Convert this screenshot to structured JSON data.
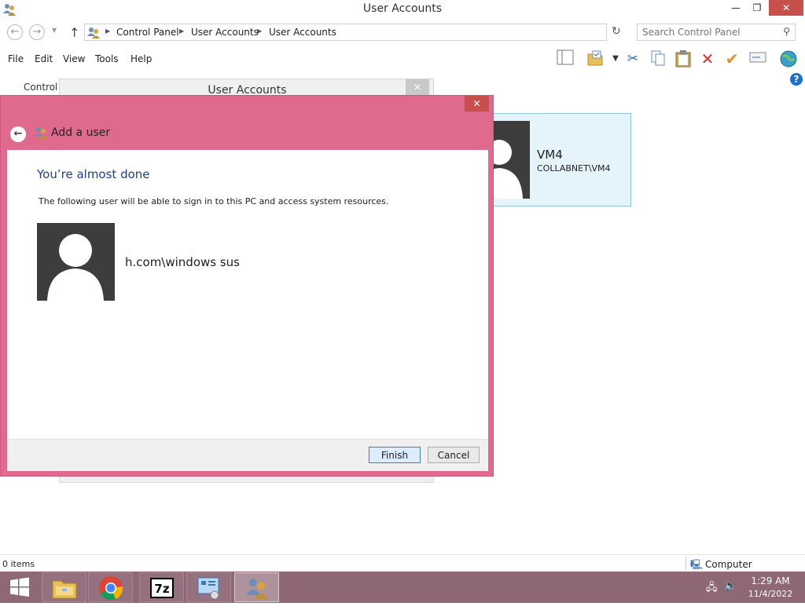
{
  "window": {
    "title": "User Accounts",
    "minimize_glyph": "—",
    "maximize_glyph": "❐",
    "close_glyph": "✕"
  },
  "address": {
    "crumbs": [
      "Control Panel",
      "User Accounts",
      "User Accounts"
    ],
    "search_placeholder": "Search Control Panel"
  },
  "menu": {
    "items": [
      "File",
      "Edit",
      "View",
      "Tools",
      "Help"
    ]
  },
  "toolbar": {
    "icons": [
      "layout-icon",
      "folder-options-icon",
      "cut-icon",
      "copy-icon",
      "paste-icon",
      "delete-icon",
      "check-icon",
      "rename-icon",
      "globe-icon"
    ]
  },
  "background": {
    "crumb": "Control P",
    "dialog_title": "User Accounts",
    "close_glyph": "✕",
    "user_tile": {
      "name": "VM4",
      "domain": "COLLABNET\\VM4"
    }
  },
  "dialog": {
    "title": "Add a user",
    "close_glyph": "✕",
    "heading": "You’re almost done",
    "description": "The following user will be able to sign in to this PC and access system resources.",
    "username": "h.com\\windows sus",
    "finish_label": "Finish",
    "cancel_label": "Cancel",
    "accent_color": "#e06a8e"
  },
  "statusbar": {
    "items_text": "0 items",
    "computer_text": "Computer"
  },
  "taskbar": {
    "color": "#8f6876",
    "time": "1:29 AM",
    "date": "11/4/2022",
    "pinned": [
      "file-explorer-icon",
      "chrome-icon",
      "7zip-icon",
      "control-panel-icon",
      "user-accounts-icon"
    ]
  }
}
